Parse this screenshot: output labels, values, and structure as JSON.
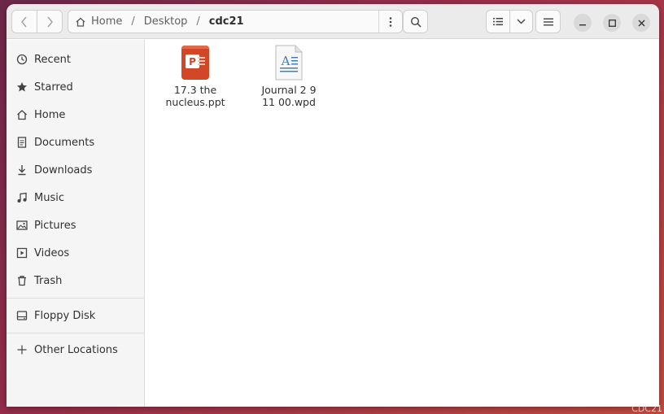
{
  "headerbar": {
    "path": [
      "Home",
      "Desktop",
      "cdc21"
    ]
  },
  "sidebar": {
    "items": [
      {
        "label": "Recent",
        "icon": "clock-icon"
      },
      {
        "label": "Starred",
        "icon": "star-icon"
      },
      {
        "label": "Home",
        "icon": "home-icon"
      },
      {
        "label": "Documents",
        "icon": "document-icon"
      },
      {
        "label": "Downloads",
        "icon": "download-icon"
      },
      {
        "label": "Music",
        "icon": "music-icon"
      },
      {
        "label": "Pictures",
        "icon": "picture-icon"
      },
      {
        "label": "Videos",
        "icon": "video-icon"
      },
      {
        "label": "Trash",
        "icon": "trash-icon"
      }
    ],
    "devices": [
      {
        "label": "Floppy Disk",
        "icon": "drive-icon"
      }
    ],
    "other": {
      "label": "Other Locations",
      "icon": "plus-icon"
    }
  },
  "files": [
    {
      "name": "17.3 the\nnucleus.ppt",
      "icon": "presentation-file-icon"
    },
    {
      "name": "Journal 2   9\n11 00.wpd",
      "icon": "text-document-file-icon"
    }
  ],
  "desktop_label": "CDC21",
  "colors": {
    "ppt_icon": "#d24726",
    "doc_icon_accent": "#3f7fbf",
    "headerbar_bg": "#ebebeb",
    "sidebar_bg": "#f5f5f5"
  }
}
